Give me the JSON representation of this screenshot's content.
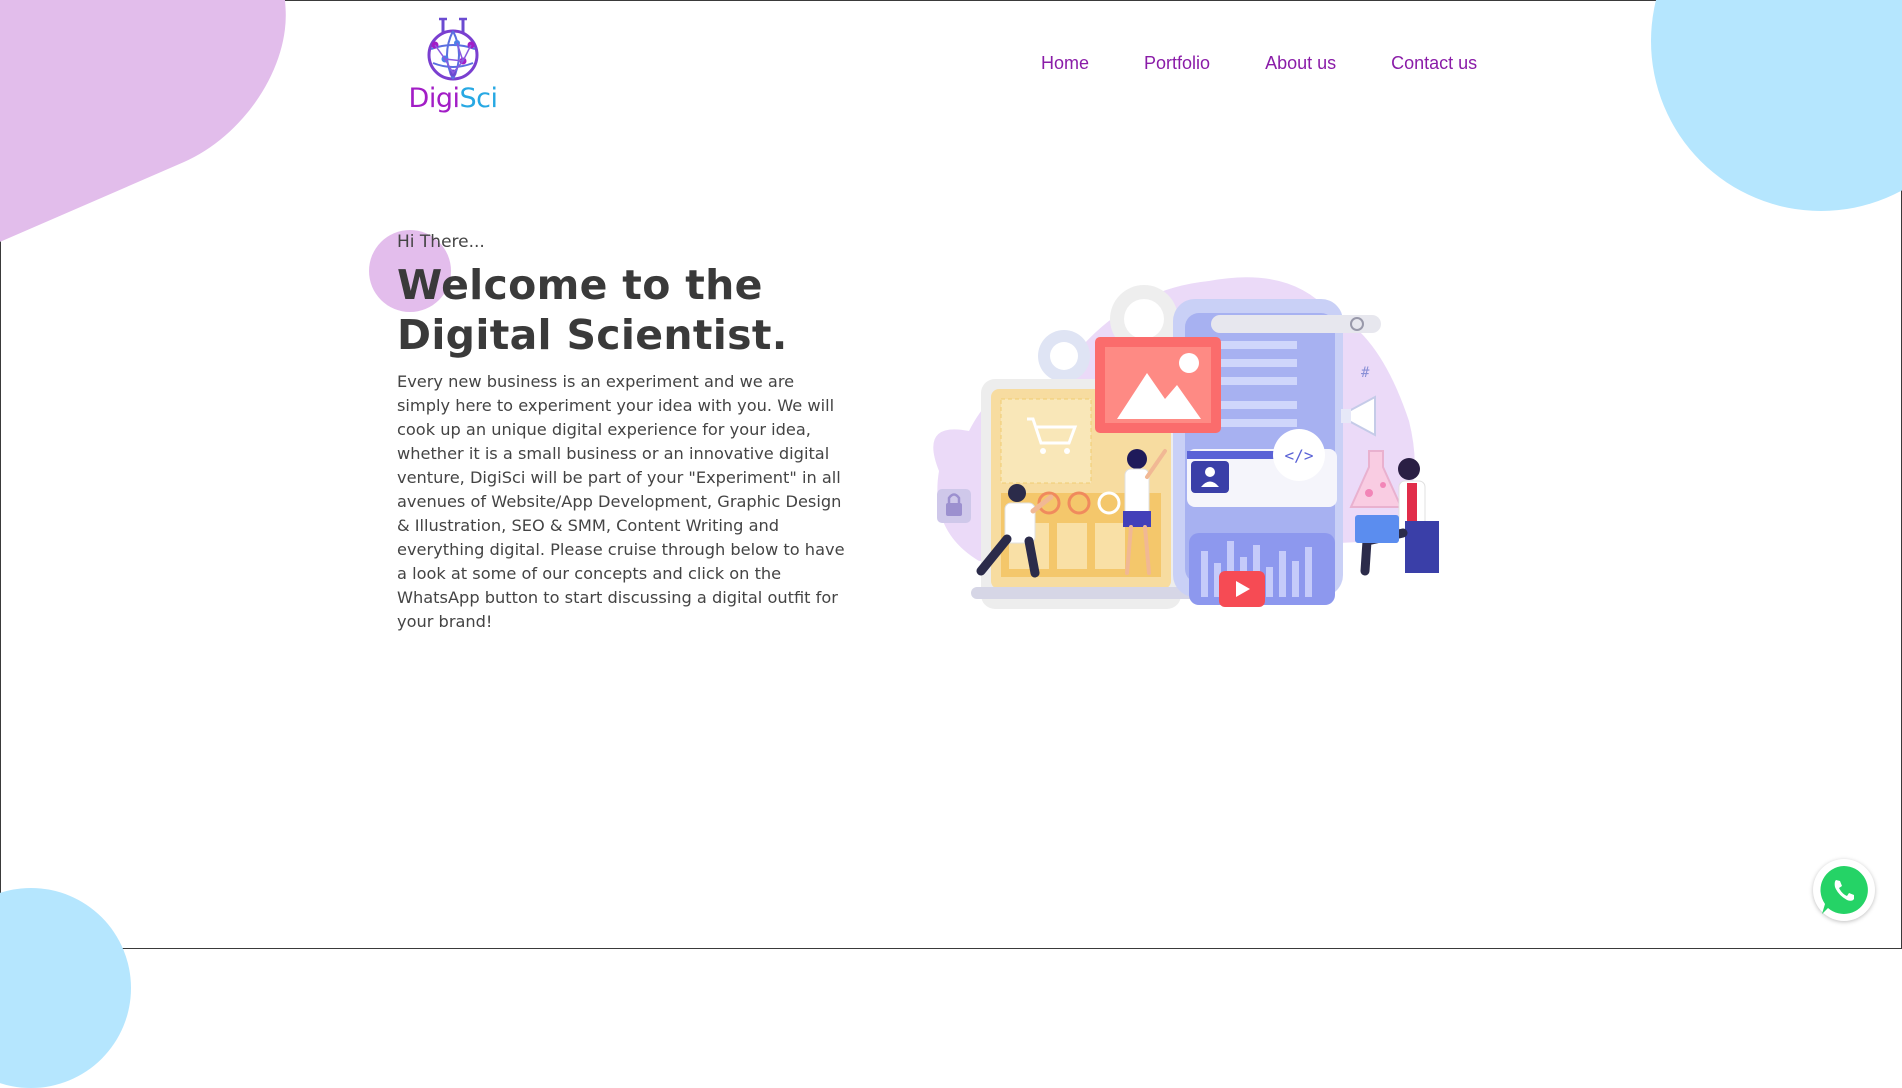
{
  "brand": {
    "part1": "Digi",
    "part2": "Sci"
  },
  "nav": [
    "Home",
    "Portfolio",
    "About us",
    "Contact us"
  ],
  "hero": {
    "greeting": "Hi There...",
    "title_line1": "Welcome to the",
    "title_line2": "Digital Scientist.",
    "description": "Every new business is an experiment and we are simply here to experiment your idea with you. We will cook up an unique digital experience for your idea, whether it is a small business or an innovative digital venture, DigiSci will be part of your \"Experiment\" in all avenues of Website/App Development, Graphic Design & Illustration, SEO & SMM, Content Writing and everything digital. Please cruise through below to have a look at some of our concepts and click on the WhatsApp button to start discussing a digital outfit for your brand!"
  },
  "illustration": {
    "code_tag": "</>",
    "hash_tag": "#"
  },
  "colors": {
    "accent_purple": "#8a1ca8",
    "brand_blue": "#27a8e3",
    "blob_pink": "#e2bdeb",
    "blob_blue": "#b5e6fe",
    "whatsapp": "#25d366"
  },
  "icons": [
    "flask-globe-icon",
    "whatsapp-icon",
    "cart-icon",
    "image-icon",
    "lock-icon",
    "megaphone-icon",
    "play-icon",
    "search-icon",
    "user-icon",
    "gear-icon"
  ]
}
